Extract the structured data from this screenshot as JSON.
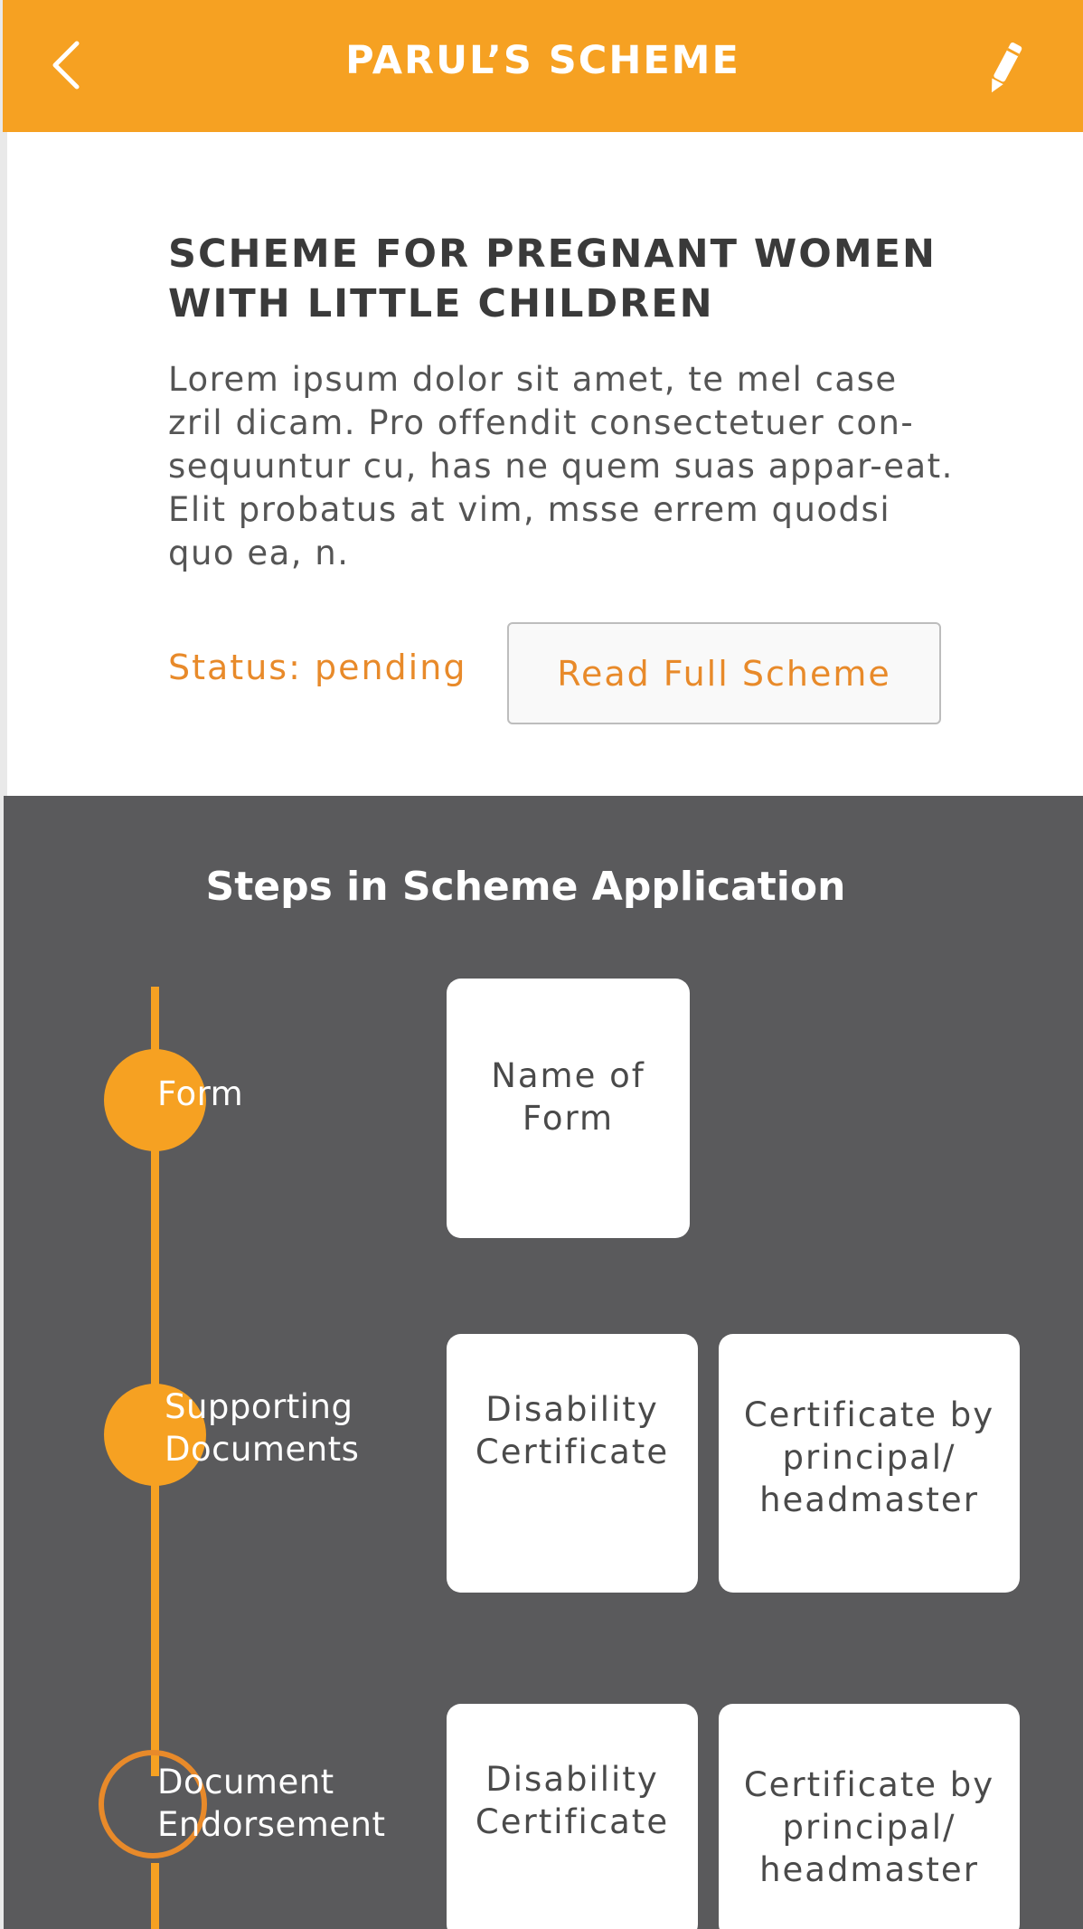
{
  "header": {
    "title": "PARUL’S SCHEME",
    "back_icon": "chevron-left-icon",
    "edit_icon": "pencil-icon",
    "background": "#f6a122"
  },
  "scheme": {
    "title": "SCHEME FOR PREGNANT WOMEN WITH LITTLE CHILDREN",
    "description": "Lorem ipsum dolor sit amet, te mel case zril dicam. Pro offendit consectetuer con-sequuntur cu, has ne quem suas appar-eat. Elit probatus at vim, msse errem quodsi quo ea, n.",
    "status": "Status: pending",
    "read_button": "Read Full Scheme"
  },
  "steps": {
    "heading": "Steps in Scheme Application",
    "items": [
      {
        "label": "Form",
        "state": "completed",
        "cards": [
          "Name of Form"
        ]
      },
      {
        "label": "Supporting Documents",
        "state": "completed",
        "cards": [
          "Disability Certificate",
          "Certificate by principal/ headmaster"
        ]
      },
      {
        "label": "Document Endorsement",
        "state": "pending",
        "cards": [
          "Disability Certificate",
          "Certificate by principal/ headmaster"
        ]
      }
    ]
  },
  "colors": {
    "accent": "#f6a122",
    "status_text": "#e88a2a",
    "steps_background": "#5a5a5c"
  }
}
